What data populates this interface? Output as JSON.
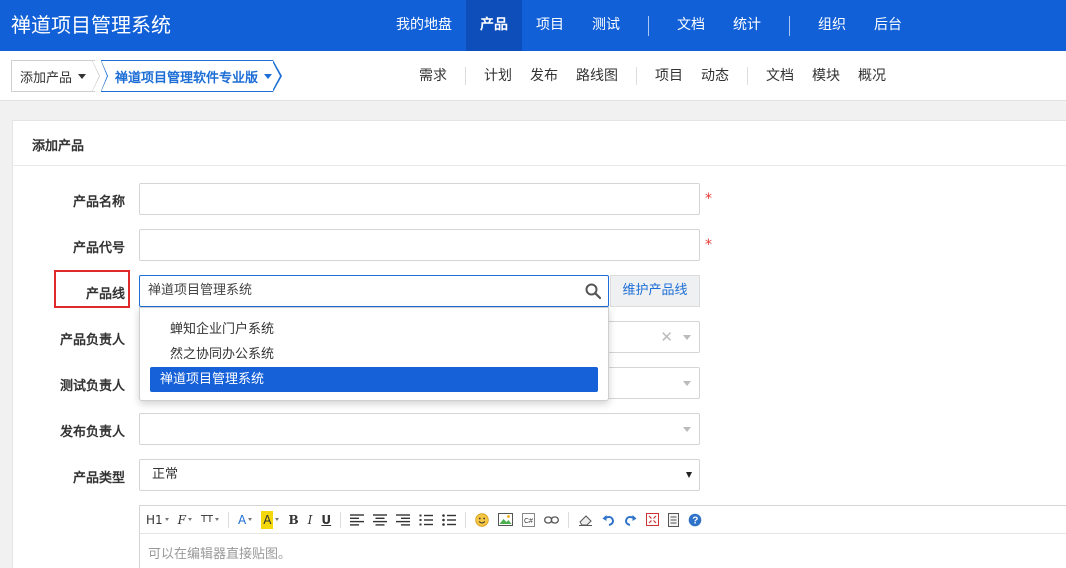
{
  "app": {
    "title": "禅道项目管理系统"
  },
  "topnav": {
    "items": [
      {
        "label": "我的地盘"
      },
      {
        "label": "产品",
        "active": true
      },
      {
        "label": "项目"
      },
      {
        "label": "测试"
      },
      {
        "label": "文档"
      },
      {
        "label": "统计"
      },
      {
        "label": "组织"
      },
      {
        "label": "后台"
      }
    ]
  },
  "breadcrumb": {
    "add_product": "添加产品",
    "current_product": "禅道项目管理软件专业版"
  },
  "subnav": {
    "items": [
      "需求",
      "计划",
      "发布",
      "路线图",
      "项目",
      "动态",
      "文档",
      "模块",
      "概况"
    ]
  },
  "form": {
    "title": "添加产品",
    "name_label": "产品名称",
    "code_label": "产品代号",
    "required_mark": "*",
    "line_label": "产品线",
    "line_value": "禅道项目管理系统",
    "line_maintain": "维护产品线",
    "line_options": [
      "蝉知企业门户系统",
      "然之协同办公系统",
      "禅道项目管理系统"
    ],
    "line_selected": "禅道项目管理系统",
    "owner_label": "产品负责人",
    "qa_label": "测试负责人",
    "release_label": "发布负责人",
    "type_label": "产品类型",
    "type_value": "正常",
    "editor_placeholder": "可以在编辑器直接贴图。"
  },
  "editor_toolbar": {
    "heading": "H1",
    "font": "F",
    "size": "TT",
    "text_color": "A",
    "bg_color": "A",
    "bold": "B",
    "italic": "I",
    "underline": "U"
  },
  "colors": {
    "header_bg": "#1160d8",
    "active_nav": "#0d4ebb",
    "accent": "#1c6ed6",
    "required": "#e53935",
    "highlight_box": "#e0292b"
  }
}
